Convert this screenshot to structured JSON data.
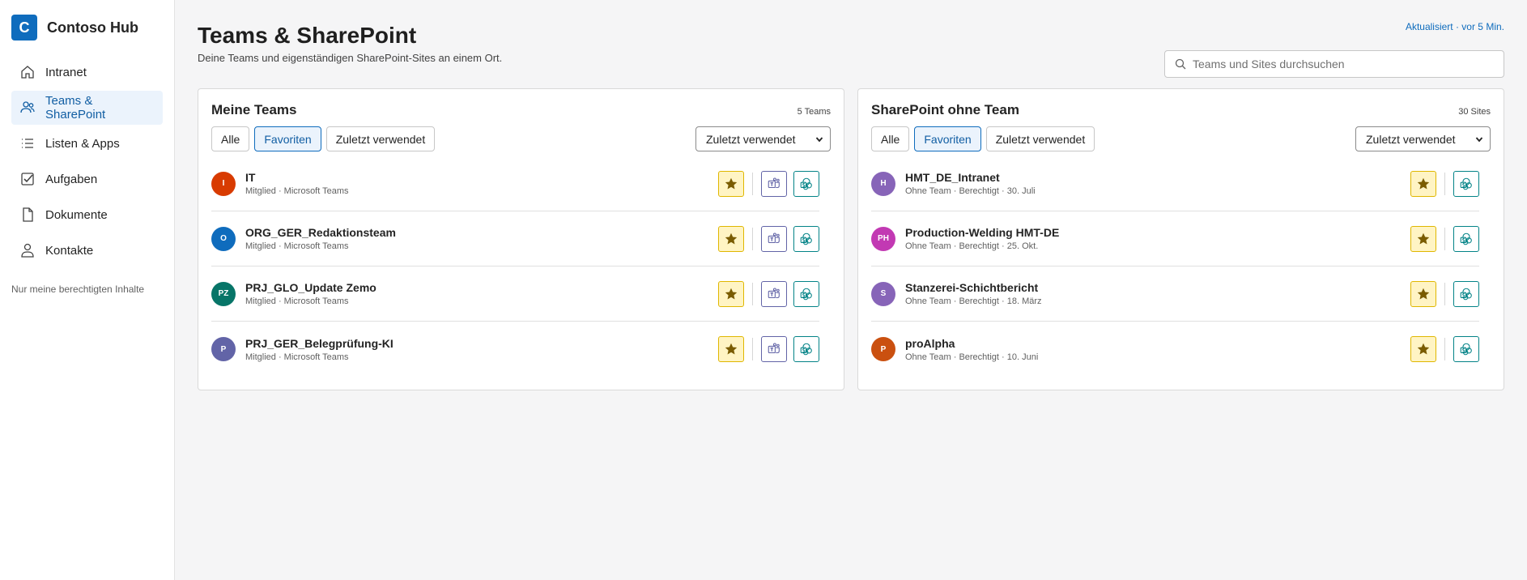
{
  "brand": {
    "logo_letter": "C",
    "name": "Contoso Hub",
    "color": "#0f6cbd"
  },
  "nav": [
    {
      "label": "Intranet",
      "icon": "home-icon",
      "active": false
    },
    {
      "label": "Teams & SharePoint",
      "icon": "people-icon",
      "active": true
    },
    {
      "label": "Listen & Apps",
      "icon": "list-icon",
      "active": false
    },
    {
      "label": "Aufgaben",
      "icon": "checkbox-icon",
      "active": false
    },
    {
      "label": "Dokumente",
      "icon": "document-icon",
      "active": false
    },
    {
      "label": "Kontakte",
      "icon": "person-icon",
      "active": false
    }
  ],
  "sidebar_note": "Nur meine berechtigten Inhalte",
  "header": {
    "title": "Teams & SharePoint",
    "subtitle": "Deine Teams und eigenständigen SharePoint-Sites an einem Ort.",
    "updated": "Aktualisiert · vor 5 Min.",
    "search_placeholder": "Teams und Sites durchsuchen"
  },
  "teams_panel": {
    "title": "Meine Teams",
    "count": "5 Teams",
    "filters": [
      "Alle",
      "Favoriten",
      "Zuletzt verwendet"
    ],
    "active_filter": "Favoriten",
    "sort": "Zuletzt verwendet",
    "items": [
      {
        "initials": "I",
        "color": "#d83b01",
        "name": "IT",
        "meta": "Mitglied · Microsoft Teams"
      },
      {
        "initials": "O",
        "color": "#0f6cbd",
        "name": "ORG_GER_Redaktionsteam",
        "meta": "Mitglied · Microsoft Teams"
      },
      {
        "initials": "PZ",
        "color": "#077568",
        "name": "PRJ_GLO_Update Zemo",
        "meta": "Mitglied · Microsoft Teams"
      },
      {
        "initials": "P",
        "color": "#6264a7",
        "name": "PRJ_GER_Belegprüfung-KI",
        "meta": "Mitglied · Microsoft Teams"
      }
    ]
  },
  "sites_panel": {
    "title": "SharePoint ohne Team",
    "count": "30 Sites",
    "filters": [
      "Alle",
      "Favoriten",
      "Zuletzt verwendet"
    ],
    "active_filter": "Favoriten",
    "sort": "Zuletzt verwendet",
    "items": [
      {
        "initials": "H",
        "color": "#8764b8",
        "name": "HMT_DE_Intranet",
        "meta": "Ohne Team · Berechtigt · 30. Juli"
      },
      {
        "initials": "PH",
        "color": "#c239b3",
        "name": "Production-Welding HMT-DE",
        "meta": "Ohne Team · Berechtigt · 25. Okt."
      },
      {
        "initials": "S",
        "color": "#8764b8",
        "name": "Stanzerei-Schichtbericht",
        "meta": "Ohne Team · Berechtigt · 18. März"
      },
      {
        "initials": "P",
        "color": "#ca5010",
        "name": "proAlpha",
        "meta": "Ohne Team · Berechtigt · 10. Juni"
      }
    ]
  }
}
